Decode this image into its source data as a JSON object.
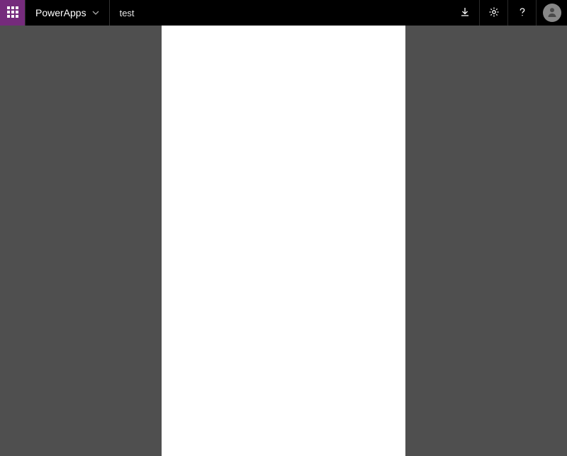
{
  "header": {
    "brand_label": "PowerApps",
    "app_name": "test"
  },
  "colors": {
    "waffle_bg": "#752b7c",
    "topbar_bg": "#000000",
    "stage_bg": "#4f4f4f",
    "canvas_bg": "#ffffff"
  }
}
